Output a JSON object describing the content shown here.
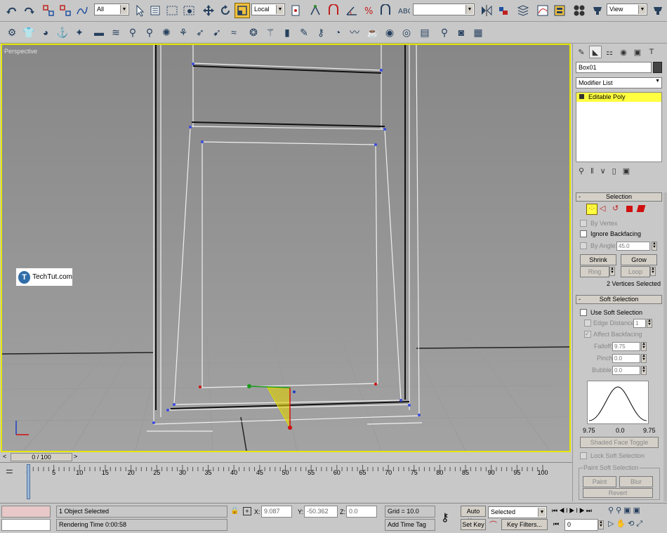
{
  "toolbar": {
    "selection_filter": "All",
    "coord_system": "Local",
    "named_sets": "",
    "view_dropdown": "View"
  },
  "viewport": {
    "label": "Perspective",
    "watermark": "TechTut.com"
  },
  "command_panel": {
    "object_name": "Box01",
    "modifier_list": "Modifier List",
    "stack_item": "Editable Poly",
    "selection_rollout": {
      "title": "Selection",
      "collapse": "-",
      "by_vertex": "By Vertex",
      "ignore_backfacing": "Ignore Backfacing",
      "by_angle": "By Angle:",
      "angle_value": "45.0",
      "shrink": "Shrink",
      "grow": "Grow",
      "ring": "Ring",
      "loop": "Loop",
      "status": "2 Vertices Selected"
    },
    "soft_selection_rollout": {
      "title": "Soft Selection",
      "collapse": "-",
      "use_soft_selection": "Use Soft Selection",
      "edge_distance": "Edge Distance:",
      "edge_distance_value": "1",
      "affect_backfacing": "Affect Backfacing",
      "falloff": "Falloff:",
      "falloff_value": "9.75",
      "pinch": "Pinch:",
      "pinch_value": "0.0",
      "bubble": "Bubble:",
      "bubble_value": "0.0",
      "curve_left": "9.75",
      "curve_mid": "0.0",
      "curve_right": "9.75",
      "shaded_face_toggle": "Shaded Face Toggle",
      "lock_soft_selection": "Lock Soft Selection",
      "paint_group": "Paint Soft Selection",
      "paint": "Paint",
      "blur": "Blur",
      "revert": "Revert"
    }
  },
  "timeline": {
    "frame_display": "0 / 100",
    "ticks": [
      "0",
      "5",
      "10",
      "15",
      "20",
      "25",
      "30",
      "35",
      "40",
      "45",
      "50",
      "55",
      "60",
      "65",
      "70",
      "75",
      "80",
      "85",
      "90",
      "95",
      "100"
    ]
  },
  "status_bar": {
    "selection_status": "1 Object Selected",
    "render_time": "Rendering Time  0:00:58",
    "x_label": "X:",
    "x_value": "9.087",
    "y_label": "Y:",
    "y_value": "-50.362",
    "z_label": "Z:",
    "z_value": "0.0",
    "grid": "Grid = 10.0",
    "add_time_tag": "Add Time Tag",
    "auto_key": "Auto Key",
    "selected_dropdown": "Selected",
    "set_key": "Set Key",
    "key_filters": "Key Filters...",
    "current_frame": "0"
  }
}
